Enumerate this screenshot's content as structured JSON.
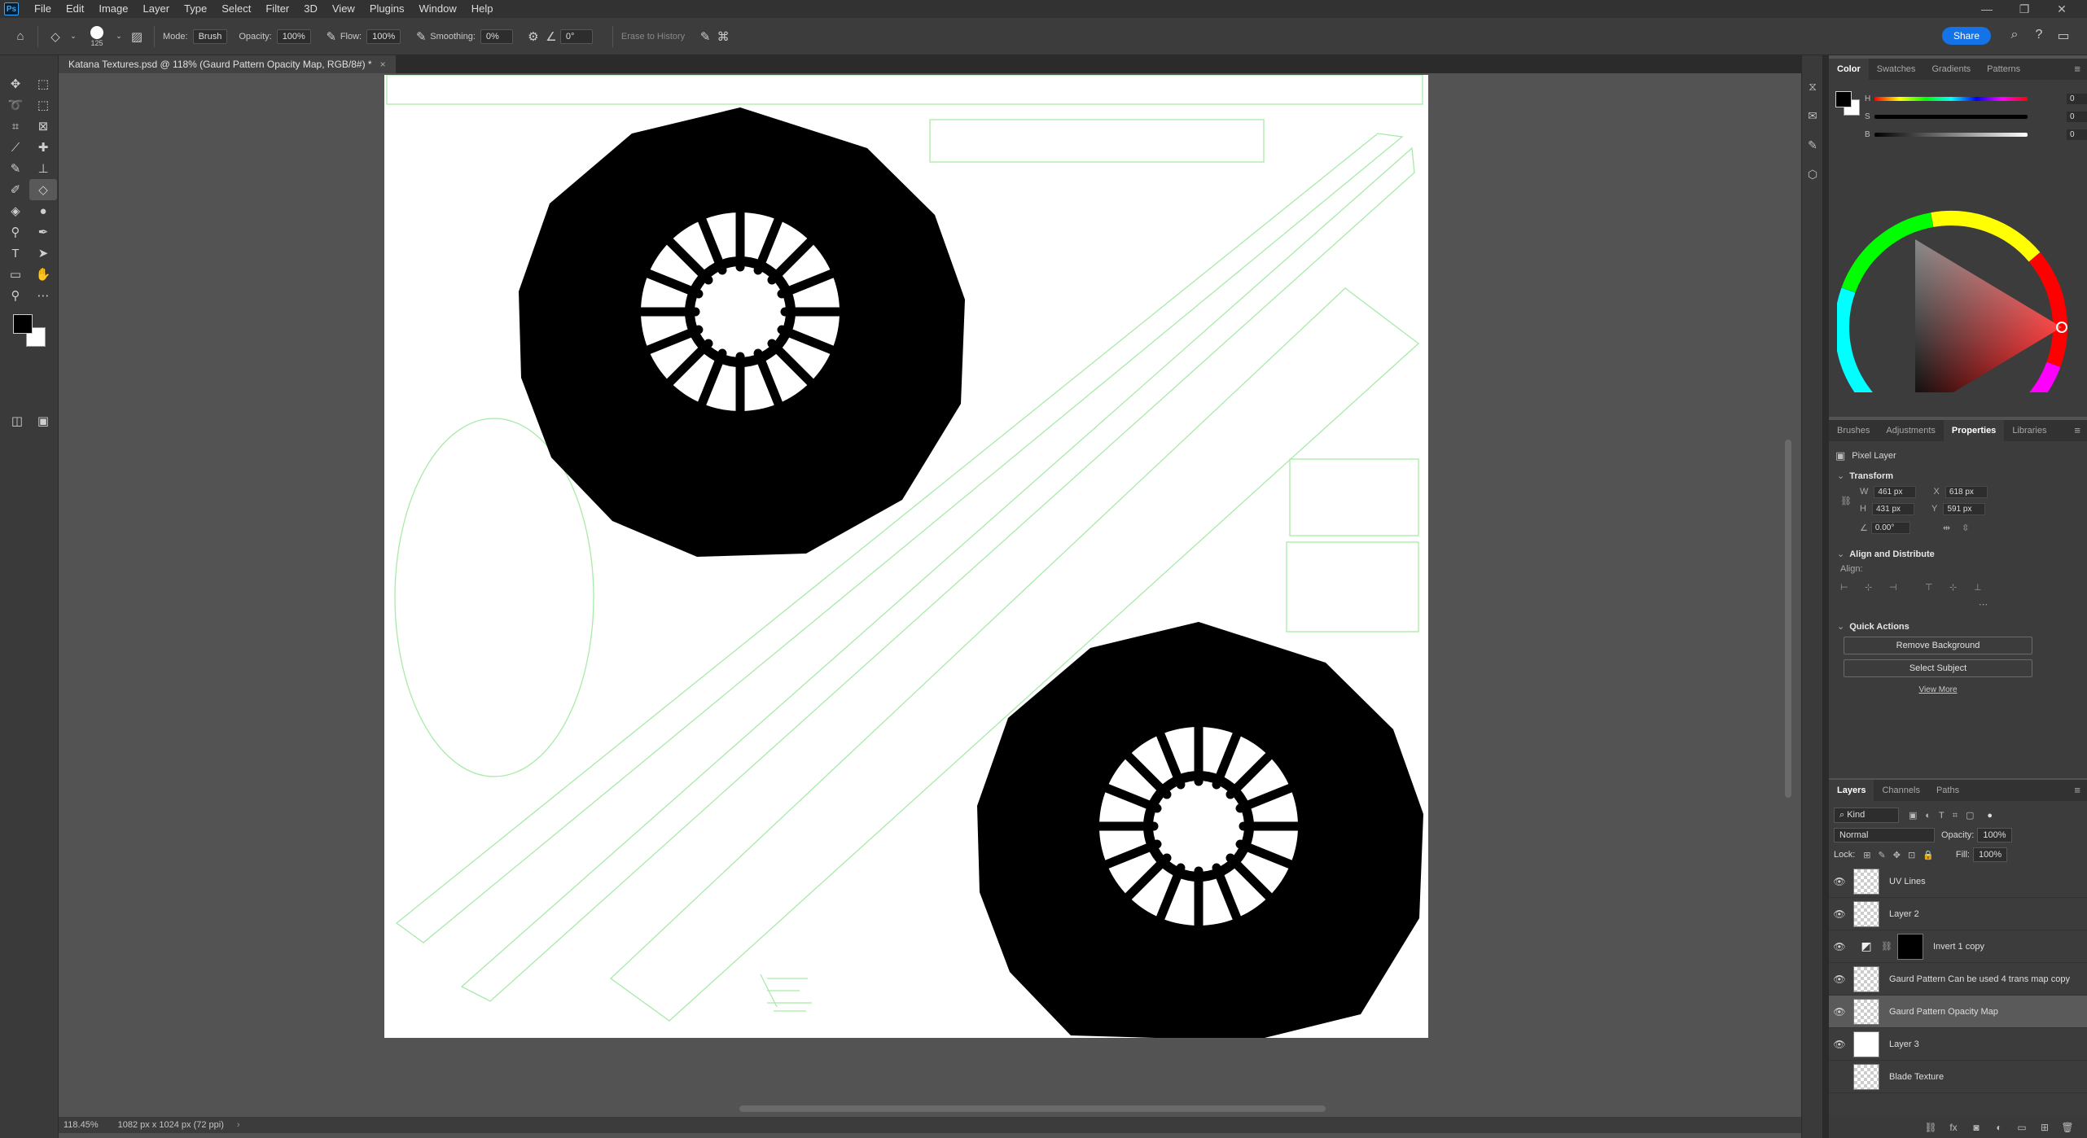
{
  "menubar": {
    "logo": "Ps",
    "items": [
      "File",
      "Edit",
      "Image",
      "Layer",
      "Type",
      "Select",
      "Filter",
      "3D",
      "View",
      "Plugins",
      "Window",
      "Help"
    ],
    "window_controls": [
      "—",
      "❐",
      "✕"
    ]
  },
  "options": {
    "brush_size": "125",
    "mode_label": "Mode:",
    "mode_value": "Brush",
    "opacity_label": "Opacity:",
    "opacity_value": "100%",
    "flow_label": "Flow:",
    "flow_value": "100%",
    "smoothing_label": "Smoothing:",
    "smoothing_value": "0%",
    "angle_value": "0°",
    "erase_history": "Erase to History",
    "share": "Share"
  },
  "document": {
    "tab_title": "Katana Textures.psd @ 118% (Gaurd Pattern Opacity Map, RGB/8#) *",
    "zoom": "118.45%",
    "dimensions": "1082 px x 1024 px (72 ppi)"
  },
  "color_panel": {
    "tabs": [
      "Color",
      "Swatches",
      "Gradients",
      "Patterns"
    ],
    "active_tab": "Color",
    "channels": [
      {
        "label": "H",
        "value": "0",
        "unit": "°"
      },
      {
        "label": "S",
        "value": "0",
        "unit": "%"
      },
      {
        "label": "B",
        "value": "0",
        "unit": "%"
      }
    ]
  },
  "properties_panel": {
    "tabs": [
      "Brushes",
      "Adjustments",
      "Properties",
      "Libraries"
    ],
    "active_tab": "Properties",
    "layer_kind": "Pixel Layer",
    "transform_header": "Transform",
    "w_label": "W",
    "w_value": "461 px",
    "h_label": "H",
    "h_value": "431 px",
    "x_label": "X",
    "x_value": "618 px",
    "y_label": "Y",
    "y_value": "591 px",
    "angle_value": "0.00°",
    "align_header": "Align and Distribute",
    "align_label": "Align:",
    "quick_actions_header": "Quick Actions",
    "remove_bg": "Remove Background",
    "select_subject": "Select Subject",
    "view_more": "View More"
  },
  "layers_panel": {
    "tabs": [
      "Layers",
      "Channels",
      "Paths"
    ],
    "active_tab": "Layers",
    "kind_filter": "Kind",
    "blend_mode": "Normal",
    "opacity_label": "Opacity:",
    "opacity_value": "100%",
    "lock_label": "Lock:",
    "fill_label": "Fill:",
    "fill_value": "100%",
    "layers": [
      {
        "name": "UV Lines",
        "visible": true,
        "active": false
      },
      {
        "name": "Layer 2",
        "visible": true,
        "active": false
      },
      {
        "name": "Invert 1 copy",
        "visible": true,
        "active": false
      },
      {
        "name": "Gaurd Pattern Can be used 4 trans map copy",
        "visible": true,
        "active": false
      },
      {
        "name": "Gaurd Pattern Opacity Map",
        "visible": true,
        "active": true
      },
      {
        "name": "Layer 3",
        "visible": true,
        "active": false
      },
      {
        "name": "Blade Texture",
        "visible": false,
        "active": false
      }
    ]
  },
  "colors": {
    "accent": "#1473e6",
    "fg_color": "#000000",
    "bg_color": "#ffffff",
    "uv_line_color": "#a8eaa8"
  }
}
